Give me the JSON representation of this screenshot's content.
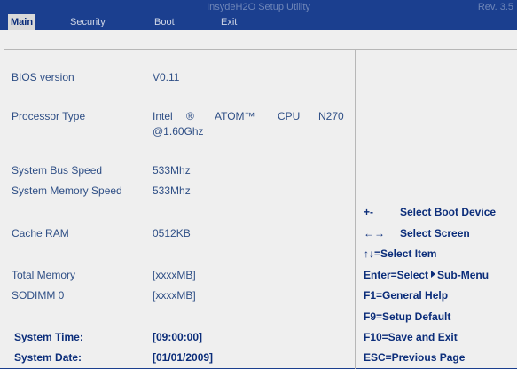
{
  "header": {
    "title": "InsydeH2O Setup Utility",
    "revision": "Rev. 3.5"
  },
  "tabs": [
    {
      "label": "Main",
      "active": true
    },
    {
      "label": "Security",
      "active": false
    },
    {
      "label": "Boot",
      "active": false
    },
    {
      "label": "Exit",
      "active": false
    }
  ],
  "main": {
    "bios_version": {
      "label": "BIOS version",
      "value": "V0.11"
    },
    "processor_type": {
      "label": "Processor Type",
      "value_parts": [
        "Intel",
        "®",
        "ATOM™",
        "CPU",
        "N270"
      ],
      "value_line2": "@1.60Ghz"
    },
    "system_bus_speed": {
      "label": "System Bus Speed",
      "value": "533Mhz"
    },
    "system_memory_speed": {
      "label": "System Memory Speed",
      "value": "533Mhz"
    },
    "cache_ram": {
      "label": "Cache RAM",
      "value": "0512KB"
    },
    "total_memory": {
      "label": "Total Memory",
      "value": "[xxxxMB]"
    },
    "sodimm0": {
      "label": "SODIMM 0",
      "value": "[xxxxMB]"
    },
    "system_time": {
      "label": "System Time:",
      "value": "[09:00:00]"
    },
    "system_date": {
      "label": "System Date:",
      "value": "[01/01/2009]"
    }
  },
  "help": {
    "boot_key": "+-",
    "boot_text": "Select Boot Device",
    "screen_key": "←→",
    "screen_text": "Select Screen",
    "item": "↑↓=Select Item",
    "enter_pre": "Enter=Select",
    "enter_post": "Sub-Menu",
    "f1": "F1=General Help",
    "f9": "F9=Setup Default",
    "f10": "F10=Save and Exit",
    "esc": "ESC=Previous Page"
  },
  "colors": {
    "header_bg": "#1b3f8f",
    "body_bg": "#efefef",
    "text": "#2f4f86",
    "bold_text": "#0b2d7a"
  }
}
